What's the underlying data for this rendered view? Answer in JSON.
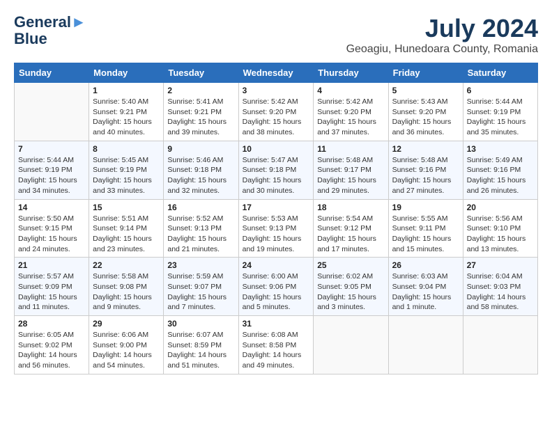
{
  "header": {
    "logo_line1": "General",
    "logo_line2": "Blue",
    "month_title": "July 2024",
    "subtitle": "Geoagiu, Hunedoara County, Romania"
  },
  "weekdays": [
    "Sunday",
    "Monday",
    "Tuesday",
    "Wednesday",
    "Thursday",
    "Friday",
    "Saturday"
  ],
  "weeks": [
    [
      {
        "num": "",
        "info": ""
      },
      {
        "num": "1",
        "info": "Sunrise: 5:40 AM\nSunset: 9:21 PM\nDaylight: 15 hours\nand 40 minutes."
      },
      {
        "num": "2",
        "info": "Sunrise: 5:41 AM\nSunset: 9:21 PM\nDaylight: 15 hours\nand 39 minutes."
      },
      {
        "num": "3",
        "info": "Sunrise: 5:42 AM\nSunset: 9:20 PM\nDaylight: 15 hours\nand 38 minutes."
      },
      {
        "num": "4",
        "info": "Sunrise: 5:42 AM\nSunset: 9:20 PM\nDaylight: 15 hours\nand 37 minutes."
      },
      {
        "num": "5",
        "info": "Sunrise: 5:43 AM\nSunset: 9:20 PM\nDaylight: 15 hours\nand 36 minutes."
      },
      {
        "num": "6",
        "info": "Sunrise: 5:44 AM\nSunset: 9:19 PM\nDaylight: 15 hours\nand 35 minutes."
      }
    ],
    [
      {
        "num": "7",
        "info": "Sunrise: 5:44 AM\nSunset: 9:19 PM\nDaylight: 15 hours\nand 34 minutes."
      },
      {
        "num": "8",
        "info": "Sunrise: 5:45 AM\nSunset: 9:19 PM\nDaylight: 15 hours\nand 33 minutes."
      },
      {
        "num": "9",
        "info": "Sunrise: 5:46 AM\nSunset: 9:18 PM\nDaylight: 15 hours\nand 32 minutes."
      },
      {
        "num": "10",
        "info": "Sunrise: 5:47 AM\nSunset: 9:18 PM\nDaylight: 15 hours\nand 30 minutes."
      },
      {
        "num": "11",
        "info": "Sunrise: 5:48 AM\nSunset: 9:17 PM\nDaylight: 15 hours\nand 29 minutes."
      },
      {
        "num": "12",
        "info": "Sunrise: 5:48 AM\nSunset: 9:16 PM\nDaylight: 15 hours\nand 27 minutes."
      },
      {
        "num": "13",
        "info": "Sunrise: 5:49 AM\nSunset: 9:16 PM\nDaylight: 15 hours\nand 26 minutes."
      }
    ],
    [
      {
        "num": "14",
        "info": "Sunrise: 5:50 AM\nSunset: 9:15 PM\nDaylight: 15 hours\nand 24 minutes."
      },
      {
        "num": "15",
        "info": "Sunrise: 5:51 AM\nSunset: 9:14 PM\nDaylight: 15 hours\nand 23 minutes."
      },
      {
        "num": "16",
        "info": "Sunrise: 5:52 AM\nSunset: 9:13 PM\nDaylight: 15 hours\nand 21 minutes."
      },
      {
        "num": "17",
        "info": "Sunrise: 5:53 AM\nSunset: 9:13 PM\nDaylight: 15 hours\nand 19 minutes."
      },
      {
        "num": "18",
        "info": "Sunrise: 5:54 AM\nSunset: 9:12 PM\nDaylight: 15 hours\nand 17 minutes."
      },
      {
        "num": "19",
        "info": "Sunrise: 5:55 AM\nSunset: 9:11 PM\nDaylight: 15 hours\nand 15 minutes."
      },
      {
        "num": "20",
        "info": "Sunrise: 5:56 AM\nSunset: 9:10 PM\nDaylight: 15 hours\nand 13 minutes."
      }
    ],
    [
      {
        "num": "21",
        "info": "Sunrise: 5:57 AM\nSunset: 9:09 PM\nDaylight: 15 hours\nand 11 minutes."
      },
      {
        "num": "22",
        "info": "Sunrise: 5:58 AM\nSunset: 9:08 PM\nDaylight: 15 hours\nand 9 minutes."
      },
      {
        "num": "23",
        "info": "Sunrise: 5:59 AM\nSunset: 9:07 PM\nDaylight: 15 hours\nand 7 minutes."
      },
      {
        "num": "24",
        "info": "Sunrise: 6:00 AM\nSunset: 9:06 PM\nDaylight: 15 hours\nand 5 minutes."
      },
      {
        "num": "25",
        "info": "Sunrise: 6:02 AM\nSunset: 9:05 PM\nDaylight: 15 hours\nand 3 minutes."
      },
      {
        "num": "26",
        "info": "Sunrise: 6:03 AM\nSunset: 9:04 PM\nDaylight: 15 hours\nand 1 minute."
      },
      {
        "num": "27",
        "info": "Sunrise: 6:04 AM\nSunset: 9:03 PM\nDaylight: 14 hours\nand 58 minutes."
      }
    ],
    [
      {
        "num": "28",
        "info": "Sunrise: 6:05 AM\nSunset: 9:02 PM\nDaylight: 14 hours\nand 56 minutes."
      },
      {
        "num": "29",
        "info": "Sunrise: 6:06 AM\nSunset: 9:00 PM\nDaylight: 14 hours\nand 54 minutes."
      },
      {
        "num": "30",
        "info": "Sunrise: 6:07 AM\nSunset: 8:59 PM\nDaylight: 14 hours\nand 51 minutes."
      },
      {
        "num": "31",
        "info": "Sunrise: 6:08 AM\nSunset: 8:58 PM\nDaylight: 14 hours\nand 49 minutes."
      },
      {
        "num": "",
        "info": ""
      },
      {
        "num": "",
        "info": ""
      },
      {
        "num": "",
        "info": ""
      }
    ]
  ]
}
